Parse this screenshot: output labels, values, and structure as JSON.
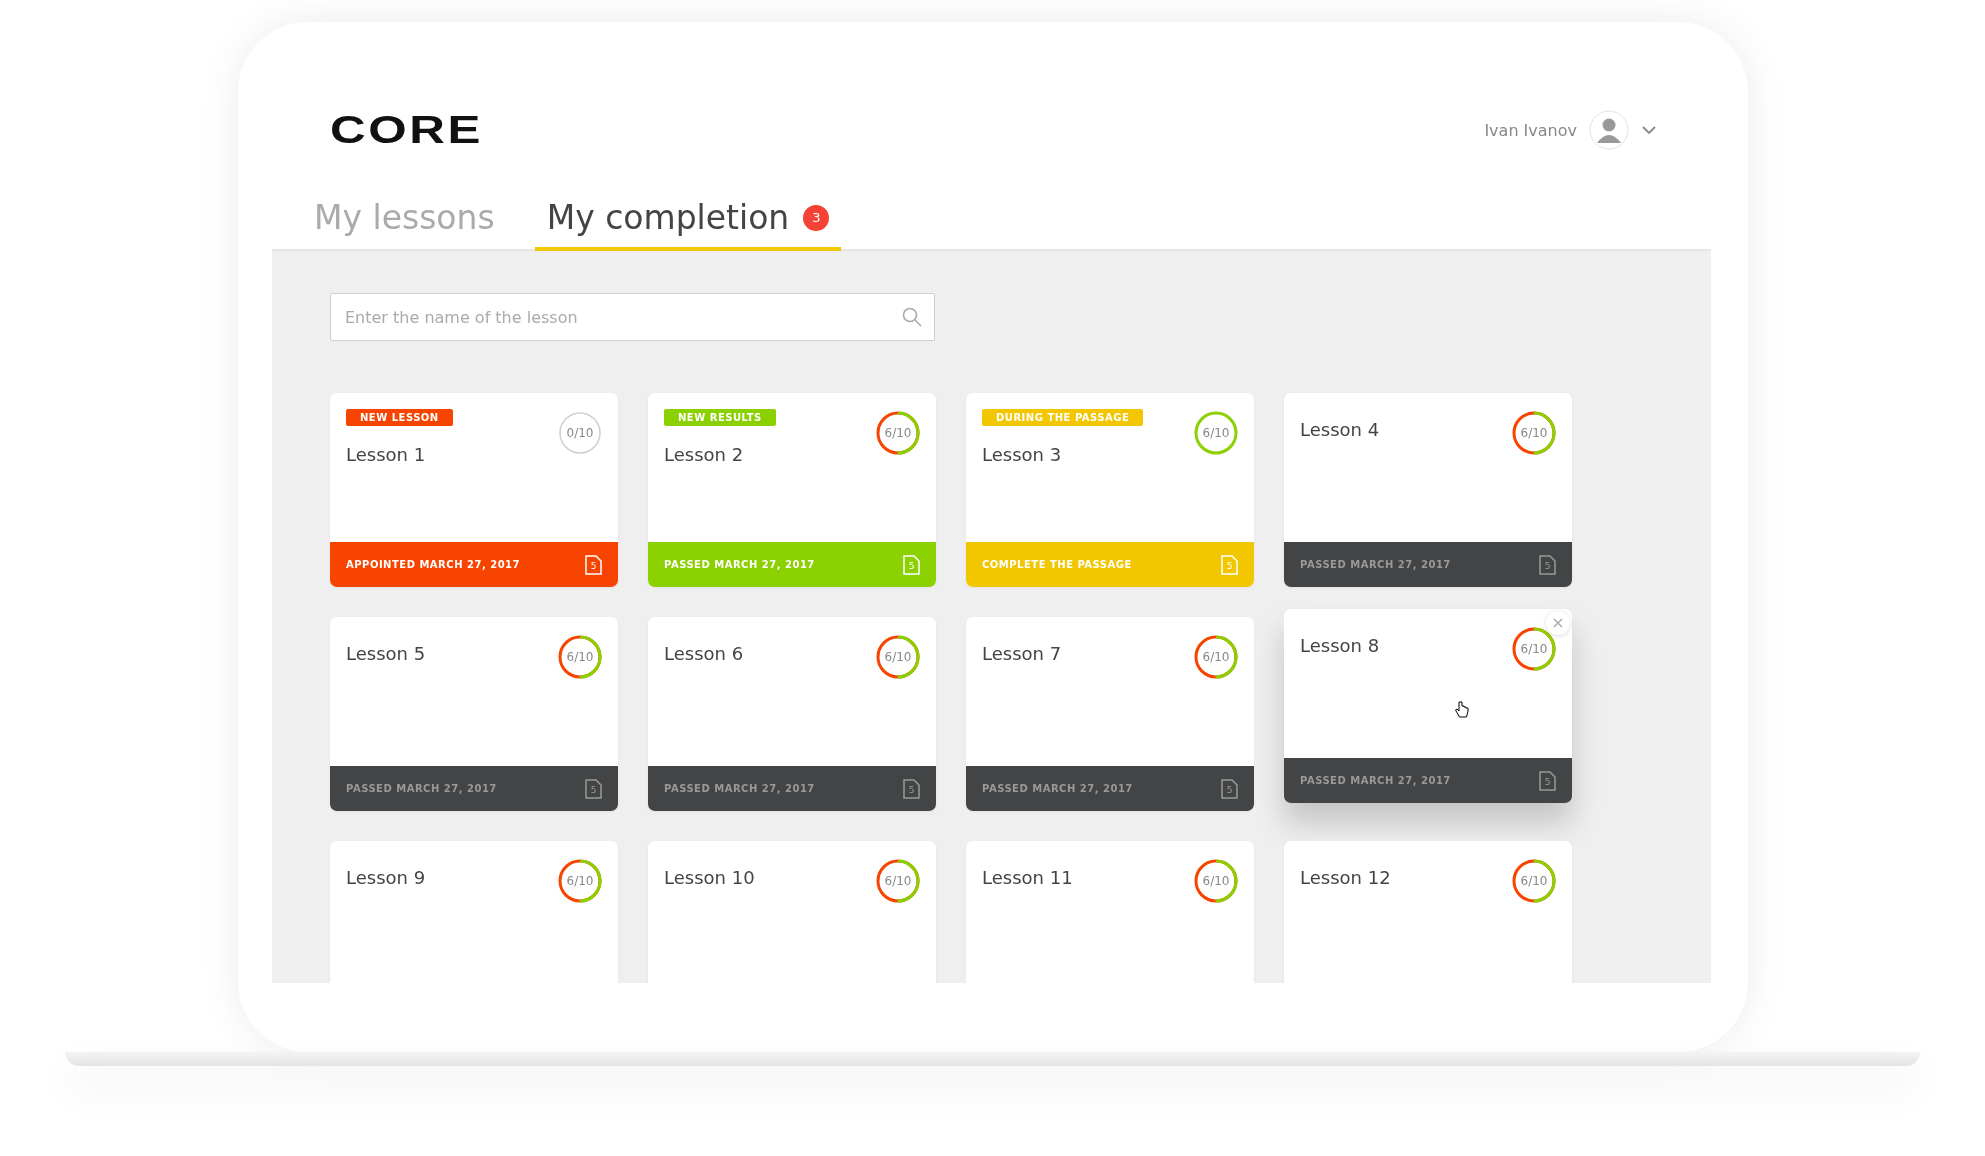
{
  "header": {
    "logo": "CORE",
    "user_name": "Ivan Ivanov"
  },
  "tabs": [
    {
      "label": "My lessons",
      "selected": false
    },
    {
      "label": "My completion",
      "selected": true,
      "badge": "3"
    }
  ],
  "search": {
    "placeholder": "Enter the name of the lesson"
  },
  "lessons": [
    {
      "title": "Lesson 1",
      "tag": "NEW LESSON",
      "color": "#f74400",
      "score": "0/10",
      "kind": "empty",
      "footer": "APPOINTED MARCH 27, 2017",
      "file_count": "5"
    },
    {
      "title": "Lesson 2",
      "tag": "NEW RESULTS",
      "color": "#8bd000",
      "score": "6/10",
      "kind": "split",
      "footer": "PASSED MARCH 27, 2017",
      "file_count": "5"
    },
    {
      "title": "Lesson 3",
      "tag": "DURING THE PASSAGE",
      "color": "#f2c600",
      "score": "6/10",
      "kind": "full",
      "footer": "COMPLETE THE PASSAGE",
      "file_count": "5"
    },
    {
      "title": "Lesson 4",
      "color": "#434446",
      "score": "6/10",
      "kind": "split",
      "footer": "PASSED MARCH 27, 2017",
      "file_count": "5"
    },
    {
      "title": "Lesson 5",
      "color": "#434446",
      "score": "6/10",
      "kind": "split",
      "footer": "PASSED MARCH 27, 2017",
      "file_count": "5"
    },
    {
      "title": "Lesson 6",
      "color": "#434446",
      "score": "6/10",
      "kind": "split",
      "footer": "PASSED MARCH 27, 2017",
      "file_count": "5"
    },
    {
      "title": "Lesson 7",
      "color": "#434446",
      "score": "6/10",
      "kind": "split",
      "footer": "PASSED MARCH 27, 2017",
      "file_count": "5"
    },
    {
      "title": "Lesson 8",
      "color": "#434446",
      "score": "6/10",
      "kind": "split",
      "footer": "PASSED MARCH 27, 2017",
      "file_count": "5",
      "close": "×"
    },
    {
      "title": "Lesson 9",
      "score": "6/10",
      "kind": "split"
    },
    {
      "title": "Lesson 10",
      "score": "6/10",
      "kind": "split"
    },
    {
      "title": "Lesson 11",
      "score": "6/10",
      "kind": "split"
    },
    {
      "title": "Lesson 12",
      "score": "6/10",
      "kind": "split"
    }
  ]
}
